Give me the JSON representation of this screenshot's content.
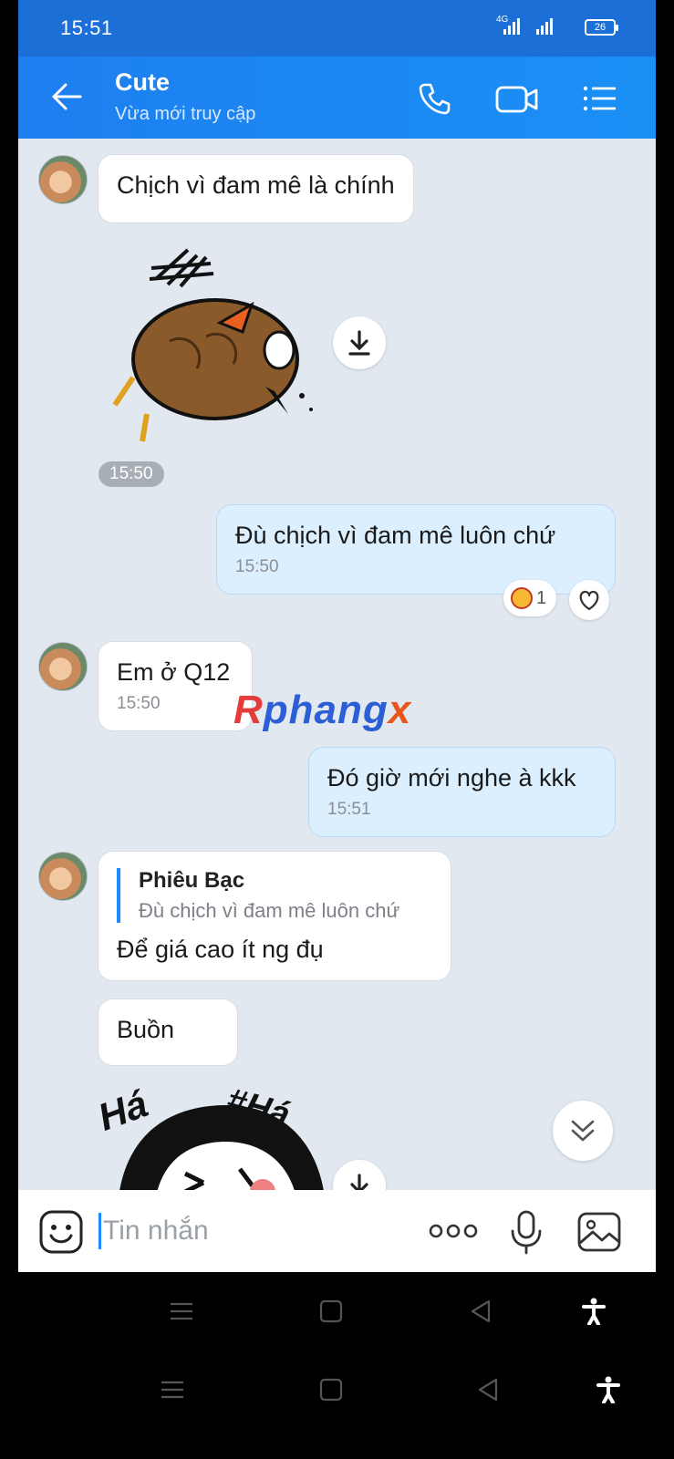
{
  "status_bar": {
    "time": "15:51",
    "network": "4G",
    "battery": "26"
  },
  "header": {
    "title": "Cute",
    "subtitle": "Vừa mới truy cập"
  },
  "messages": [
    {
      "text": "Chịch vì đam mê là chính"
    },
    {
      "time": "15:50"
    },
    {
      "text": "Đù chịch vì đam mê luôn chứ",
      "time": "15:50",
      "reaction_count": "1"
    },
    {
      "text": "Em ở Q12",
      "time": "15:50"
    },
    {
      "text": "Đó giờ mới nghe à kkk",
      "time": "15:51"
    },
    {
      "quote_name": "Phiêu Bạc",
      "quote_text": "Đù chịch vì đam mê luôn chứ",
      "text": "Để giá cao ít ng đụ"
    },
    {
      "text": "Buồn"
    }
  ],
  "sticker_text": {
    "left": "Há",
    "right": "#Há"
  },
  "watermark": {
    "p1": "R",
    "p2": "phang",
    "p3": "x"
  },
  "input": {
    "placeholder": "Tin nhắn"
  }
}
